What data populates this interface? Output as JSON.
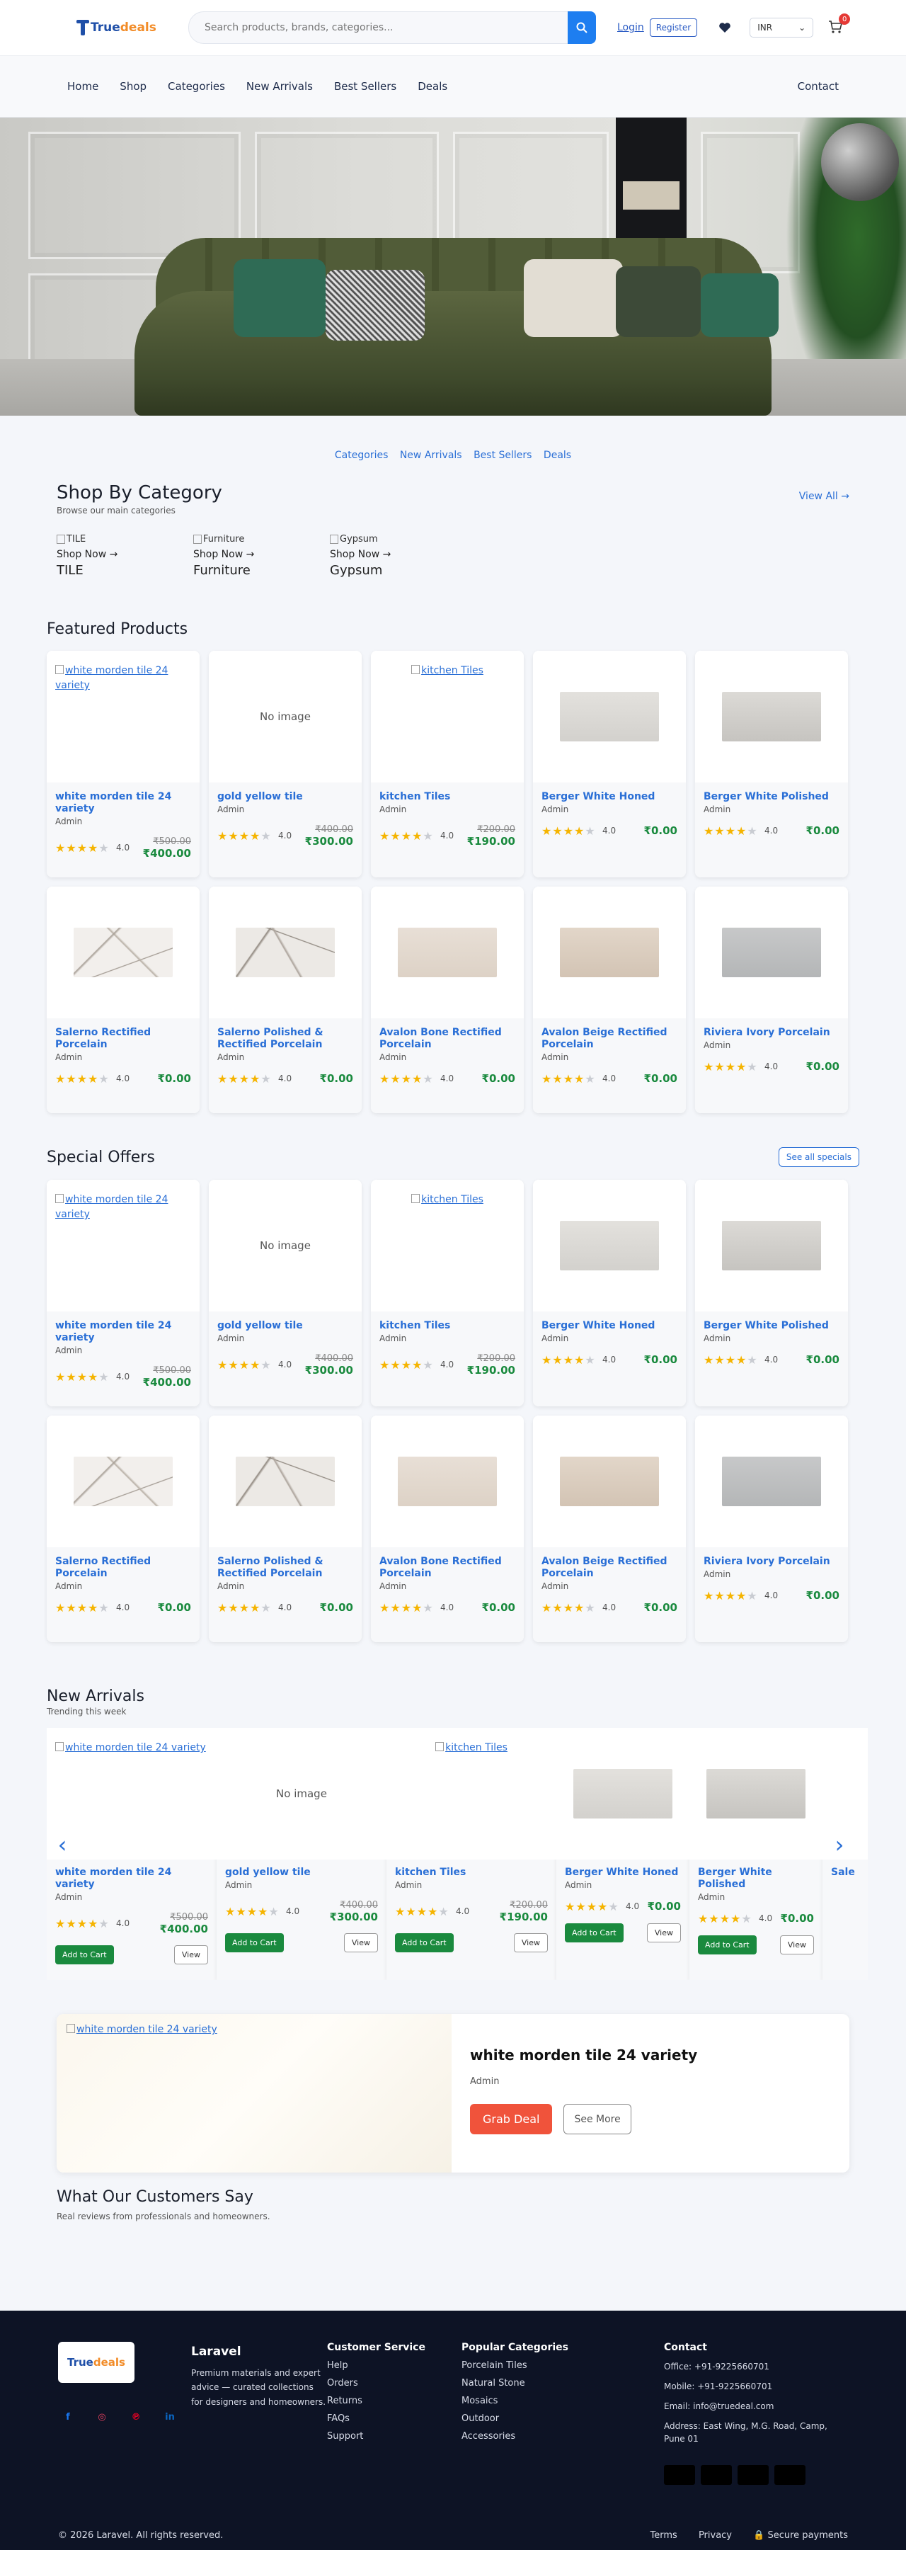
{
  "header": {
    "logo_text_1": "True",
    "logo_text_2": "deals",
    "search_placeholder": "Search products, brands, categories...",
    "login": "Login",
    "register": "Register",
    "currency": "INR",
    "cart_count": "0"
  },
  "nav": {
    "items": [
      "Home",
      "Shop",
      "Categories",
      "New Arrivals",
      "Best Sellers",
      "Deals"
    ],
    "contact": "Contact"
  },
  "sublinks": [
    "Categories",
    "New Arrivals",
    "Best Sellers",
    "Deals"
  ],
  "categories": {
    "title": "Shop By Category",
    "subtitle": "Browse our main categories",
    "view_all": "View All →",
    "items": [
      {
        "alt": "TILE",
        "shop": "Shop Now →",
        "name": "TILE"
      },
      {
        "alt": "Furniture",
        "shop": "Shop Now →",
        "name": "Furniture"
      },
      {
        "alt": "Gypsum",
        "shop": "Shop Now →",
        "name": "Gypsum"
      }
    ]
  },
  "featured": {
    "title": "Featured Products",
    "products": [
      {
        "name": "white morden tile 24 variety",
        "author": "Admin",
        "rating": "4.0",
        "old": "₹500.00",
        "price": "₹400.00"
      },
      {
        "name": "gold yellow tile",
        "author": "Admin",
        "rating": "4.0",
        "old": "₹400.00",
        "price": "₹300.00"
      },
      {
        "name": "kitchen Tiles",
        "author": "Admin",
        "rating": "4.0",
        "old": "₹200.00",
        "price": "₹190.00"
      },
      {
        "name": "Berger White Honed",
        "author": "Admin",
        "rating": "4.0",
        "old": "",
        "price": "₹0.00"
      },
      {
        "name": "Berger White Polished",
        "author": "Admin",
        "rating": "4.0",
        "old": "",
        "price": "₹0.00"
      },
      {
        "name": "Salerno Rectified Porcelain",
        "author": "Admin",
        "rating": "4.0",
        "old": "",
        "price": "₹0.00"
      },
      {
        "name": "Salerno Polished & Rectified Porcelain",
        "author": "Admin",
        "rating": "4.0",
        "old": "",
        "price": "₹0.00"
      },
      {
        "name": "Avalon Bone Rectified Porcelain",
        "author": "Admin",
        "rating": "4.0",
        "old": "",
        "price": "₹0.00"
      },
      {
        "name": "Avalon Beige Rectified Porcelain",
        "author": "Admin",
        "rating": "4.0",
        "old": "",
        "price": "₹0.00"
      },
      {
        "name": "Riviera Ivory Porcelain",
        "author": "Admin",
        "rating": "4.0",
        "old": "",
        "price": "₹0.00"
      }
    ]
  },
  "special": {
    "title": "Special Offers",
    "see_all": "See all specials"
  },
  "thumbs": {
    "alt_white": "white morden tile 24 variety",
    "no_image": "No image",
    "alt_kitchen": "kitchen Tiles"
  },
  "new_arrivals": {
    "title": "New Arrivals",
    "subtitle": "Trending this week",
    "add_to_cart": "Add to Cart",
    "view": "View",
    "partial_name": "Sale"
  },
  "deal": {
    "image_alt": "white morden tile 24 variety",
    "title": "white morden tile 24 variety",
    "author": "Admin",
    "grab": "Grab Deal",
    "more": "See More"
  },
  "testimonials": {
    "title": "What Our Customers Say",
    "subtitle": "Real reviews from professionals and homeowners."
  },
  "footer": {
    "brand": "Laravel",
    "desc": "Premium materials and expert advice — curated collections for designers and homeowners.",
    "customer_service": {
      "title": "Customer Service",
      "links": [
        "Help",
        "Orders",
        "Returns",
        "FAQs",
        "Support"
      ]
    },
    "popular": {
      "title": "Popular Categories",
      "links": [
        "Porcelain Tiles",
        "Natural Stone",
        "Mosaics",
        "Outdoor",
        "Accessories"
      ]
    },
    "contact": {
      "title": "Contact",
      "office": "Office: +91-9225660701",
      "mobile": "Mobile: +91-9225660701",
      "email": "Email: info@truedeal.com",
      "address": "Address: East Wing, M.G. Road, Camp, Pune 01"
    },
    "copyright": "© 2026 Laravel. All rights reserved.",
    "terms": "Terms",
    "privacy": "Privacy",
    "secure": "Secure payments"
  },
  "colors": {
    "accent": "#2a6fd6",
    "price": "#1a8a3e",
    "grab": "#f0533b",
    "footer": "#0d1325",
    "star": "#f5b400"
  }
}
